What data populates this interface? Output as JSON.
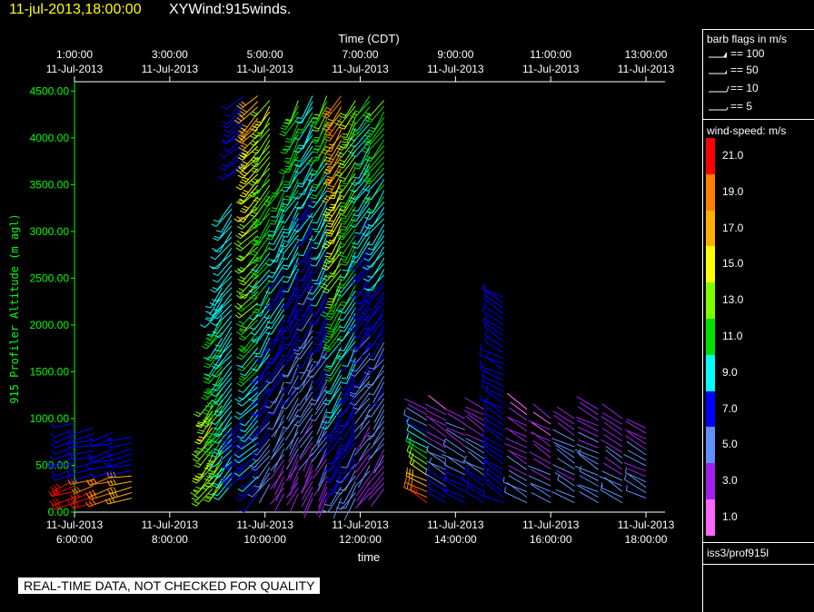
{
  "header": {
    "datetime": "11-jul-2013,18:00:00",
    "title": "XYWind:915winds."
  },
  "chart_data": {
    "type": "wind-barb time-height plot",
    "top_axis_title": "Time (CDT)",
    "top_ticks": [
      {
        "x": 6,
        "l1": "1:00:00",
        "l2": "11-Jul-2013"
      },
      {
        "x": 8,
        "l1": "3:00:00",
        "l2": "11-Jul-2013"
      },
      {
        "x": 10,
        "l1": "5:00:00",
        "l2": "11-Jul-2013"
      },
      {
        "x": 12,
        "l1": "7:00:00",
        "l2": "11-Jul-2013"
      },
      {
        "x": 14,
        "l1": "9:00:00",
        "l2": "11-Jul-2013"
      },
      {
        "x": 16,
        "l1": "11:00:00",
        "l2": "11-Jul-2013"
      },
      {
        "x": 18,
        "l1": "13:00:00",
        "l2": "11-Jul-2013"
      }
    ],
    "bottom_ticks": [
      {
        "x": 6,
        "l1": "11-Jul-2013",
        "l2": "6:00:00"
      },
      {
        "x": 8,
        "l1": "11-Jul-2013",
        "l2": "8:00:00"
      },
      {
        "x": 10,
        "l1": "11-Jul-2013",
        "l2": "10:00:00"
      },
      {
        "x": 12,
        "l1": "11-Jul-2013",
        "l2": "12:00:00"
      },
      {
        "x": 14,
        "l1": "11-Jul-2013",
        "l2": "14:00:00"
      },
      {
        "x": 16,
        "l1": "11-Jul-2013",
        "l2": "16:00:00"
      },
      {
        "x": 18,
        "l1": "11-Jul-2013",
        "l2": "18:00:00"
      }
    ],
    "xlabel": "time",
    "ylabel": "915 Profiler Altitude (m agl)",
    "xlim": [
      6,
      18.4
    ],
    "ylim": [
      0,
      4600
    ],
    "y_ticks": [
      "0.00",
      "500.00",
      "1000.00",
      "1500.00",
      "2000.00",
      "2500.00",
      "3000.00",
      "3500.00",
      "4000.00",
      "4500.00"
    ],
    "profiles": [
      {
        "t": 6.0,
        "zmin": 100,
        "zmax": 950,
        "sfc": 7,
        "top": 7,
        "dir": 250,
        "lowband": 22
      },
      {
        "t": 6.4,
        "zmin": 100,
        "zmax": 900,
        "sfc": 7,
        "top": 7,
        "dir": 255,
        "lowband": 20
      },
      {
        "t": 6.8,
        "zmin": 150,
        "zmax": 850,
        "sfc": 7,
        "top": 7,
        "dir": 255,
        "lowband": 19
      },
      {
        "t": 7.2,
        "zmin": 150,
        "zmax": 800,
        "sfc": 7,
        "top": 7,
        "dir": 260,
        "lowband": 17
      },
      {
        "t": 8.9,
        "zmin": 250,
        "zmax": 1200,
        "sfc": 13,
        "top": 14,
        "dir": 215
      },
      {
        "t": 9.1,
        "zmin": 300,
        "zmax": 2400,
        "sfc": 13,
        "top": 9,
        "dir": 215
      },
      {
        "t": 9.3,
        "zmin": 300,
        "zmax": 3300,
        "sfc": 9,
        "top": 9,
        "dir": 220
      },
      {
        "t": 9.55,
        "zmin": 400,
        "zmax": 1000,
        "sfc": 7,
        "top": 7,
        "dir": 230
      },
      {
        "t": 9.55,
        "zmin": 3700,
        "zmax": 4450,
        "sfc": 7,
        "top": 7,
        "dir": 230
      },
      {
        "t": 9.85,
        "zmin": 200,
        "zmax": 4450,
        "sfc": 7,
        "top": 17,
        "dir": 225
      },
      {
        "t": 10.1,
        "zmin": 300,
        "zmax": 4400,
        "sfc": 5,
        "top": 14,
        "dir": 215
      },
      {
        "t": 10.4,
        "zmin": 200,
        "zmax": 3600,
        "sfc": 3,
        "top": 11,
        "dir": 210
      },
      {
        "t": 10.7,
        "zmin": 200,
        "zmax": 4400,
        "sfc": 3,
        "top": 12,
        "dir": 210
      },
      {
        "t": 11.0,
        "zmin": 150,
        "zmax": 4450,
        "sfc": 3,
        "top": 10,
        "dir": 210
      },
      {
        "t": 11.3,
        "zmin": 150,
        "zmax": 4450,
        "sfc": 3,
        "top": 12,
        "dir": 210
      },
      {
        "t": 11.6,
        "zmin": 150,
        "zmax": 4450,
        "sfc": 5,
        "top": 19,
        "dir": 210
      },
      {
        "t": 11.9,
        "zmin": 150,
        "zmax": 4400,
        "sfc": 5,
        "top": 14,
        "dir": 210
      },
      {
        "t": 12.2,
        "zmin": 200,
        "zmax": 4450,
        "sfc": 3,
        "top": 11,
        "dir": 215
      },
      {
        "t": 12.5,
        "zmin": 250,
        "zmax": 4400,
        "sfc": 3,
        "top": 12,
        "dir": 215
      },
      {
        "t": 13.4,
        "zmin": 100,
        "zmax": 1100,
        "sfc": 21,
        "top": 2,
        "dir": 300
      },
      {
        "t": 13.8,
        "zmin": 100,
        "zmax": 1100,
        "sfc": 7,
        "top": 2,
        "dir": 300
      },
      {
        "t": 14.2,
        "zmin": 100,
        "zmax": 1000,
        "sfc": 7,
        "top": 3,
        "dir": 300
      },
      {
        "t": 14.6,
        "zmin": 100,
        "zmax": 1100,
        "sfc": 7,
        "top": 2,
        "dir": 300
      },
      {
        "t": 15.0,
        "zmin": 100,
        "zmax": 2300,
        "sfc": 7,
        "top": 7,
        "dir": 300
      },
      {
        "t": 15.5,
        "zmin": 100,
        "zmax": 1100,
        "sfc": 5,
        "top": 2,
        "dir": 300
      },
      {
        "t": 16.0,
        "zmin": 100,
        "zmax": 1000,
        "sfc": 5,
        "top": 2,
        "dir": 300
      },
      {
        "t": 16.5,
        "zmin": 100,
        "zmax": 1000,
        "sfc": 5,
        "top": 3,
        "dir": 300
      },
      {
        "t": 17.0,
        "zmin": 100,
        "zmax": 1100,
        "sfc": 5,
        "top": 3,
        "dir": 300
      },
      {
        "t": 17.5,
        "zmin": 100,
        "zmax": 1000,
        "sfc": 5,
        "top": 3,
        "dir": 300
      },
      {
        "t": 18.0,
        "zmin": 150,
        "zmax": 900,
        "sfc": 5,
        "top": 3,
        "dir": 300
      }
    ]
  },
  "sidebar": {
    "barb_title": "barb flags in m/s",
    "barb_flags": [
      "== 100",
      "== 50",
      "== 10",
      "== 5"
    ],
    "speed_title": "wind-speed: m/s",
    "speed_scale": [
      {
        "label": "21.0",
        "color": "#ff0000"
      },
      {
        "label": "19.0",
        "color": "#ff8000"
      },
      {
        "label": "17.0",
        "color": "#ffb000"
      },
      {
        "label": "15.0",
        "color": "#ffff00"
      },
      {
        "label": "13.0",
        "color": "#80ff00"
      },
      {
        "label": "11.0",
        "color": "#00e000"
      },
      {
        "label": "9.0",
        "color": "#00ffff"
      },
      {
        "label": "7.0",
        "color": "#0000ff"
      },
      {
        "label": "5.0",
        "color": "#6090ff"
      },
      {
        "label": "3.0",
        "color": "#a020f0"
      },
      {
        "label": "1.0",
        "color": "#ff66ff"
      }
    ],
    "source": "iss3/prof915l"
  },
  "qc_banner": "REAL-TIME DATA, NOT CHECKED FOR QUALITY",
  "colors": {
    "axis": "#ffffff",
    "yaxis": "#00ff00",
    "header_date": "#ffff00",
    "background": "#000000"
  }
}
